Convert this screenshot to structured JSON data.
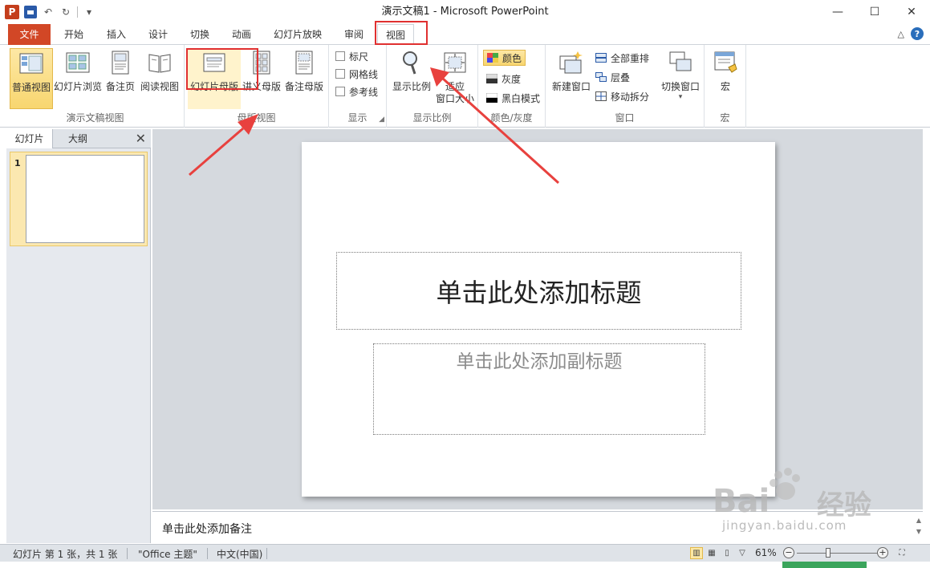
{
  "window": {
    "title": "演示文稿1 - Microsoft PowerPoint",
    "app_icon_letter": "P",
    "minimize": "—",
    "maximize": "☐",
    "close": "✕"
  },
  "qat": {
    "undo": "↶",
    "redo": "↻",
    "customize": "▾"
  },
  "tabs": {
    "file": "文件",
    "home": "开始",
    "insert": "插入",
    "design": "设计",
    "transitions": "切换",
    "animations": "动画",
    "slideshow": "幻灯片放映",
    "review": "审阅",
    "view": "视图",
    "collapse": "△",
    "help": "?"
  },
  "ribbon": {
    "presentation_views": {
      "label": "演示文稿视图",
      "normal": "普通视图",
      "sorter": "幻灯片浏览",
      "notes_page": "备注页",
      "reading": "阅读视图"
    },
    "master_views": {
      "label": "母版视图",
      "slide_master": "幻灯片母版",
      "handout_master": "讲义母版",
      "notes_master": "备注母版"
    },
    "show": {
      "label": "显示",
      "ruler": "标尺",
      "gridlines": "网格线",
      "guides": "参考线"
    },
    "zoom": {
      "label": "显示比例",
      "zoom": "显示比例",
      "fit_line1": "适应",
      "fit_line2": "窗口大小"
    },
    "color": {
      "label": "颜色/灰度",
      "color": "颜色",
      "grayscale": "灰度",
      "bw": "黑白模式"
    },
    "window": {
      "label": "窗口",
      "new_window": "新建窗口",
      "arrange_all": "全部重排",
      "cascade": "层叠",
      "move_split": "移动拆分",
      "switch_windows": "切换窗口"
    },
    "macros": {
      "label": "宏",
      "macros": "宏"
    }
  },
  "left_pane": {
    "tab_slides": "幻灯片",
    "tab_outline": "大纲",
    "close": "✕",
    "slide_number": "1"
  },
  "slide": {
    "title_placeholder": "单击此处添加标题",
    "subtitle_placeholder": "单击此处添加副标题"
  },
  "notes": {
    "placeholder": "单击此处添加备注"
  },
  "status": {
    "slide_info": "幻灯片 第 1 张，共 1 张",
    "theme": "\"Office 主题\"",
    "language": "中文(中国)",
    "zoom": "61%",
    "zoom_out": "−",
    "zoom_in": "+",
    "zoom_level": 0.39
  },
  "watermark": {
    "brand": "Bai",
    "brand2": "经验",
    "url": "jingyan.baidu.com"
  },
  "colors": {
    "file_tab": "#d24726",
    "annotation": "#e03030",
    "selected": "#f8d66f"
  }
}
